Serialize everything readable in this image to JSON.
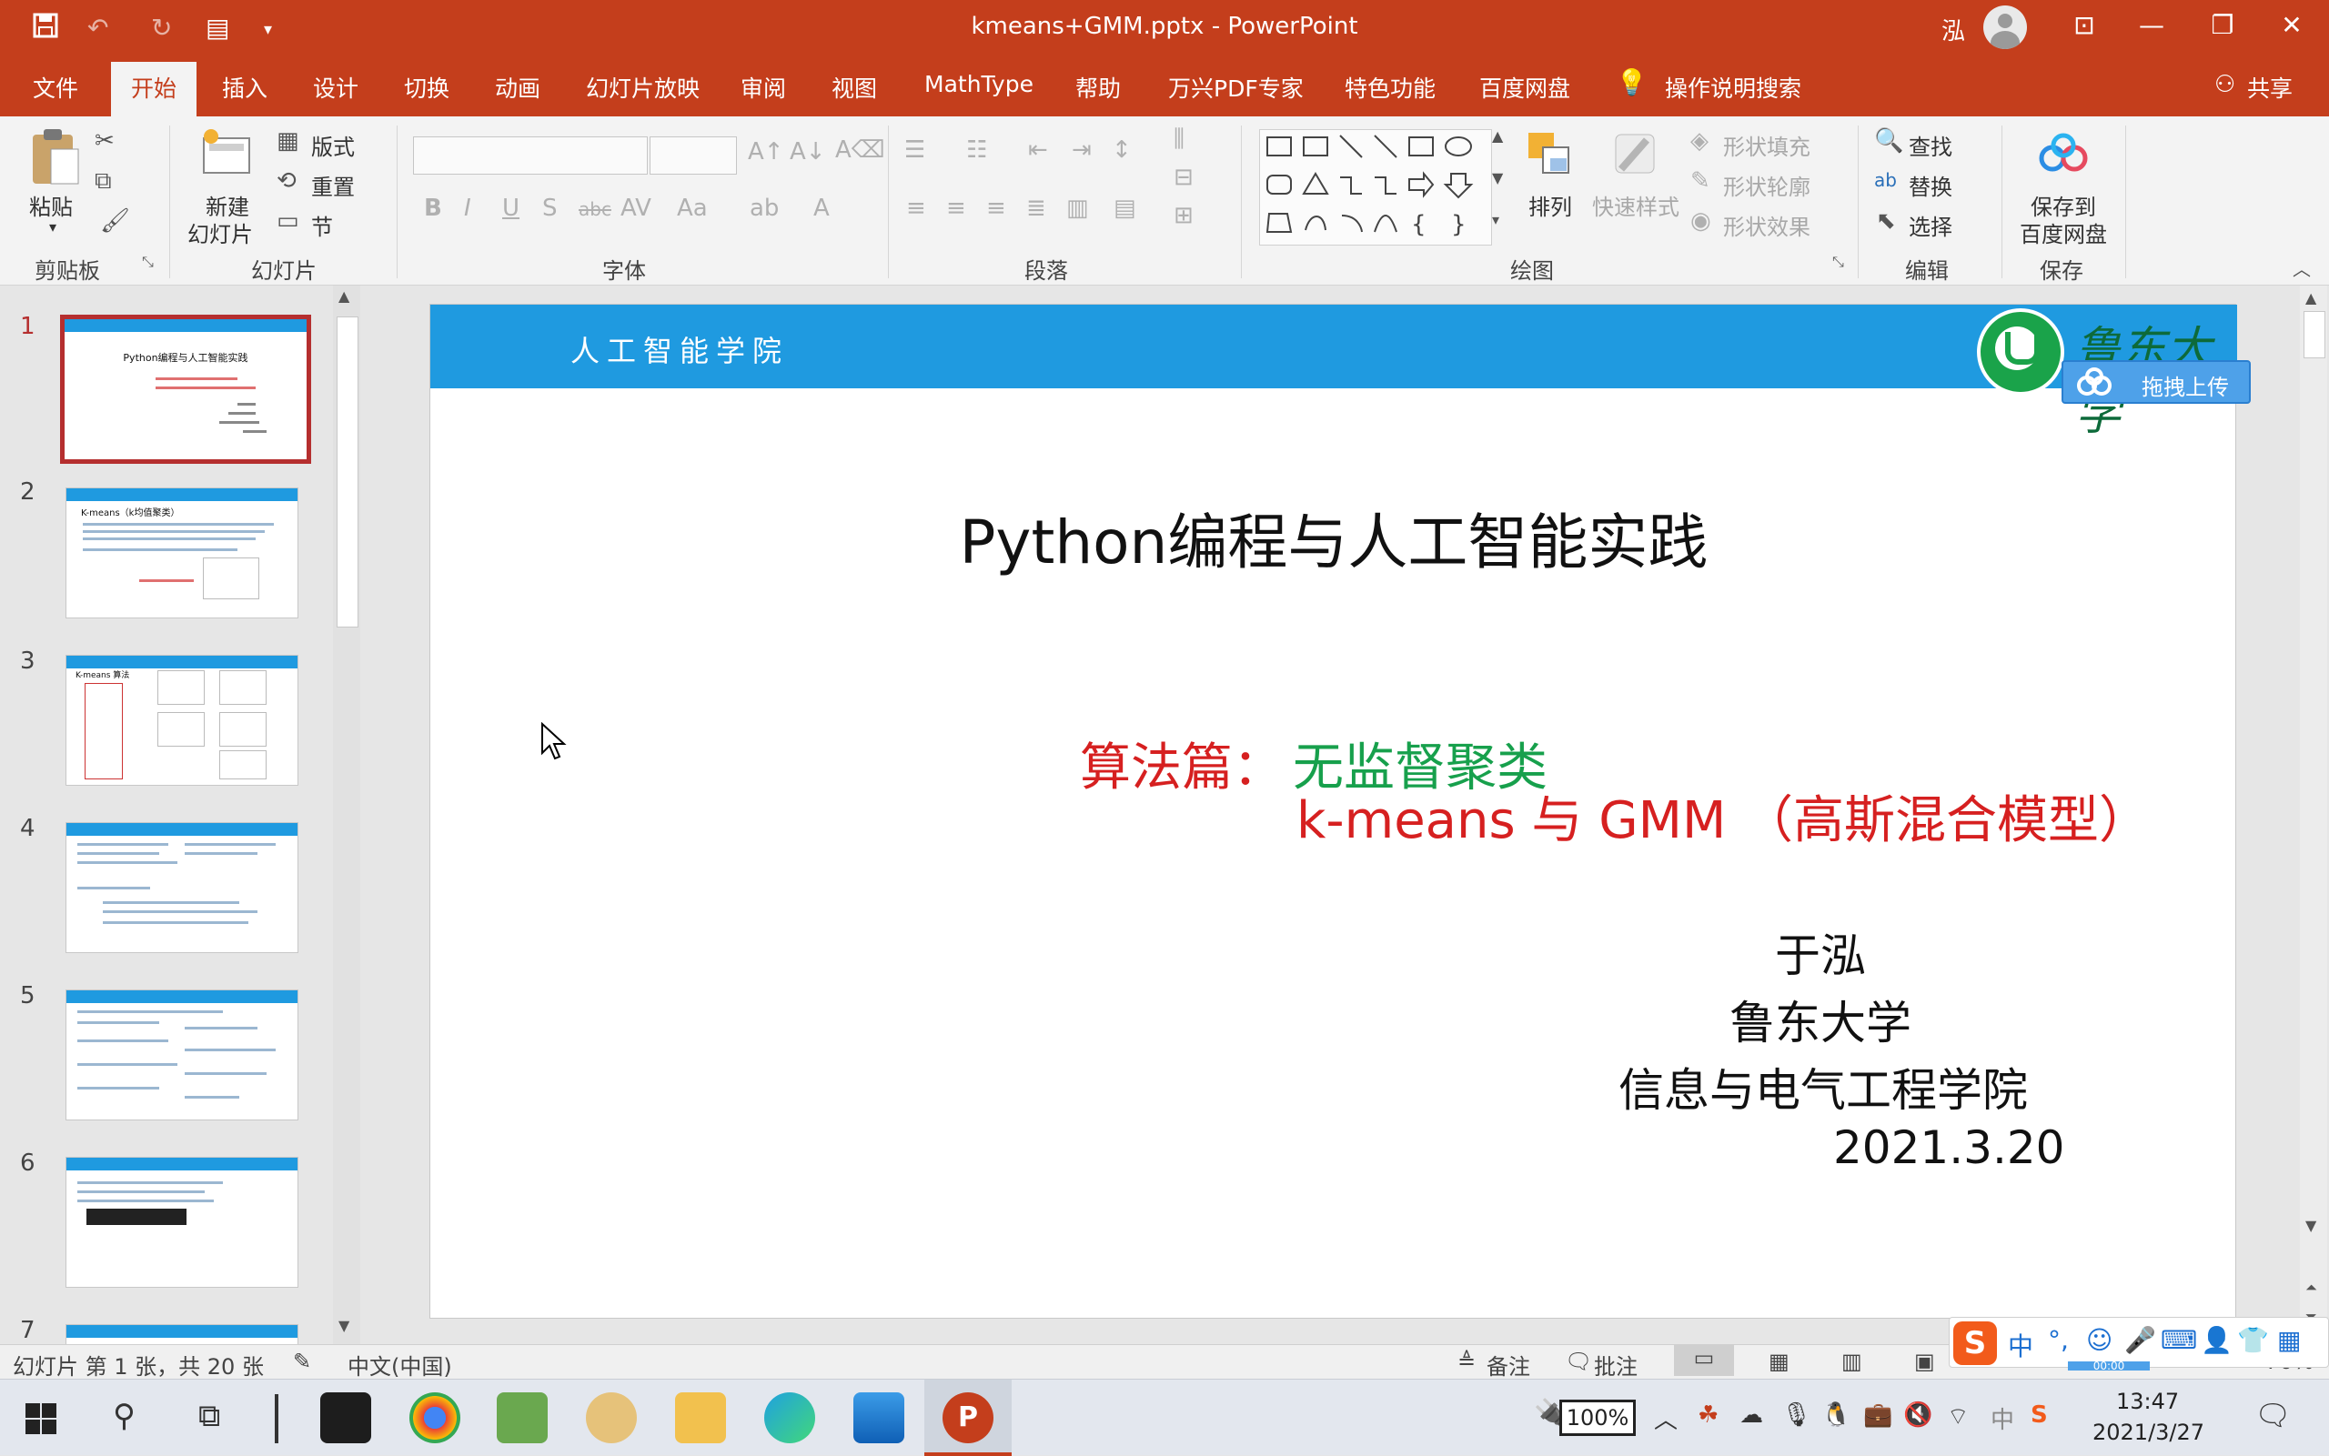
{
  "window": {
    "title": "kmeans+GMM.pptx  -  PowerPoint",
    "user_name": "泓"
  },
  "tabs": {
    "file": "文件",
    "home": "开始",
    "insert": "插入",
    "design": "设计",
    "transitions": "切换",
    "animations": "动画",
    "slideshow": "幻灯片放映",
    "review": "审阅",
    "view": "视图",
    "mathtype": "MathType",
    "help": "帮助",
    "wanxing": "万兴PDF专家",
    "features": "特色功能",
    "baidu": "百度网盘",
    "tell_me": "操作说明搜索",
    "share": "共享"
  },
  "ribbon": {
    "clipboard": {
      "label": "剪贴板",
      "paste": "粘贴"
    },
    "slides": {
      "label": "幻灯片",
      "new_slide_1": "新建",
      "new_slide_2": "幻灯片",
      "layout": "版式",
      "reset": "重置",
      "section": "节"
    },
    "font": {
      "label": "字体"
    },
    "paragraph": {
      "label": "段落"
    },
    "drawing": {
      "label": "绘图",
      "arrange": "排列",
      "quick_styles": "快速样式",
      "shape_fill": "形状填充",
      "shape_outline": "形状轮廓",
      "shape_effects": "形状效果"
    },
    "editing": {
      "label": "编辑",
      "find": "查找",
      "replace": "替换",
      "select": "选择"
    },
    "save": {
      "label": "保存",
      "save_to_1": "保存到",
      "save_to_2": "百度网盘"
    }
  },
  "thumbnails": [
    {
      "num": "1",
      "title": "Python编程与人工智能实践"
    },
    {
      "num": "2",
      "title": "K-means（k均值聚类）"
    },
    {
      "num": "3",
      "title": "K-means 算法"
    },
    {
      "num": "4"
    },
    {
      "num": "5"
    },
    {
      "num": "6"
    },
    {
      "num": "7"
    }
  ],
  "slide": {
    "school": "人工智能学院",
    "university": "鲁东大学",
    "upload_badge": "拖拽上传",
    "title": "Python编程与人工智能实践",
    "subtitle_prefix": "算法篇：",
    "subtitle_topic": "无监督聚类",
    "subtitle_line2": "k-means 与 GMM （高斯混合模型）",
    "author": "于泓",
    "affiliation": "鲁东大学",
    "department": "信息与电气工程学院",
    "date": "2021.3.20"
  },
  "statusbar": {
    "slide_info": "幻灯片 第 1 张，共 20 张",
    "language": "中文(中国)",
    "notes": "备注",
    "comments": "批注",
    "zoom_partial": "70%",
    "timer": "00:00"
  },
  "taskbar": {
    "battery": "100%",
    "ime": "中",
    "time": "13:47",
    "date": "2021/3/27"
  },
  "colors": {
    "accent": "#c43e1c",
    "slide_header": "#1f9ae0",
    "subtitle_red": "#d62020",
    "subtitle_green": "#17a04c"
  }
}
